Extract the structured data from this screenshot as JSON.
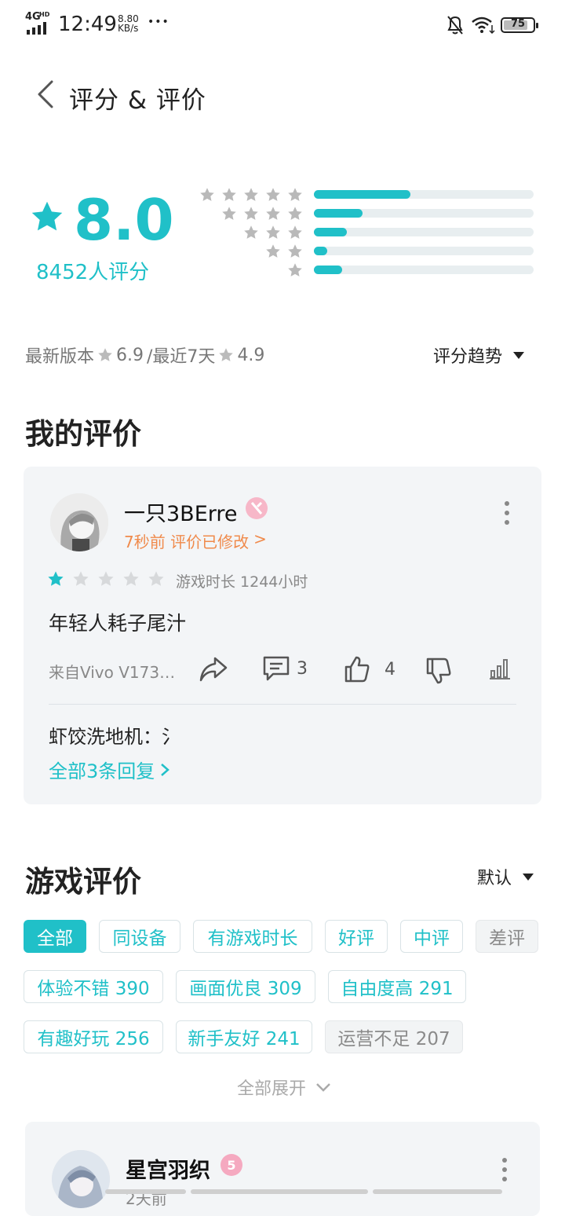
{
  "status_bar": {
    "network": "4G",
    "network_sup": "HD",
    "time": "12:49",
    "speed_value": "8.80",
    "speed_unit": "KB/s",
    "dots": "•••",
    "battery": "75"
  },
  "header": {
    "title": "评分 & 评价"
  },
  "rating": {
    "score": "8.0",
    "count": "8452人评分",
    "distribution": [
      {
        "stars": 5,
        "fraction": 0.44
      },
      {
        "stars": 4,
        "fraction": 0.22
      },
      {
        "stars": 3,
        "fraction": 0.15
      },
      {
        "stars": 2,
        "fraction": 0.06
      },
      {
        "stars": 1,
        "fraction": 0.13
      }
    ]
  },
  "version_row": {
    "latest_label": "最新版本",
    "latest_score": "6.9",
    "recent_label": "/最近7天",
    "recent_score": "4.9",
    "trend_label": "评分趋势"
  },
  "my_review": {
    "section_title": "我的评价",
    "username": "一只3BErre",
    "meta": "7秒前 评价已修改",
    "meta_arrow": ">",
    "rating": 1,
    "playtime": "游戏时长 1244小时",
    "content": "年轻人耗子尾汁",
    "device": "来自Vivo V173…",
    "comments": "3",
    "likes": "4",
    "reply_preview": "虾饺洗地机：氵",
    "all_replies": "全部3条回复"
  },
  "game_reviews": {
    "section_title": "游戏评价",
    "sort": "默认",
    "filters_row1": [
      "全部",
      "同设备",
      "有游戏时长",
      "好评",
      "中评",
      "差评"
    ],
    "tags_row2": [
      "体验不错 390",
      "画面优良 309",
      "自由度高 291"
    ],
    "tags_row3": [
      "有趣好玩 256",
      "新手友好 241",
      "运营不足 207"
    ],
    "expand_label": "全部展开"
  },
  "next_review": {
    "username": "星宫羽织",
    "meta": "2天前"
  },
  "colors": {
    "accent": "#20c0c8",
    "meta_orange": "#f08a4b"
  }
}
